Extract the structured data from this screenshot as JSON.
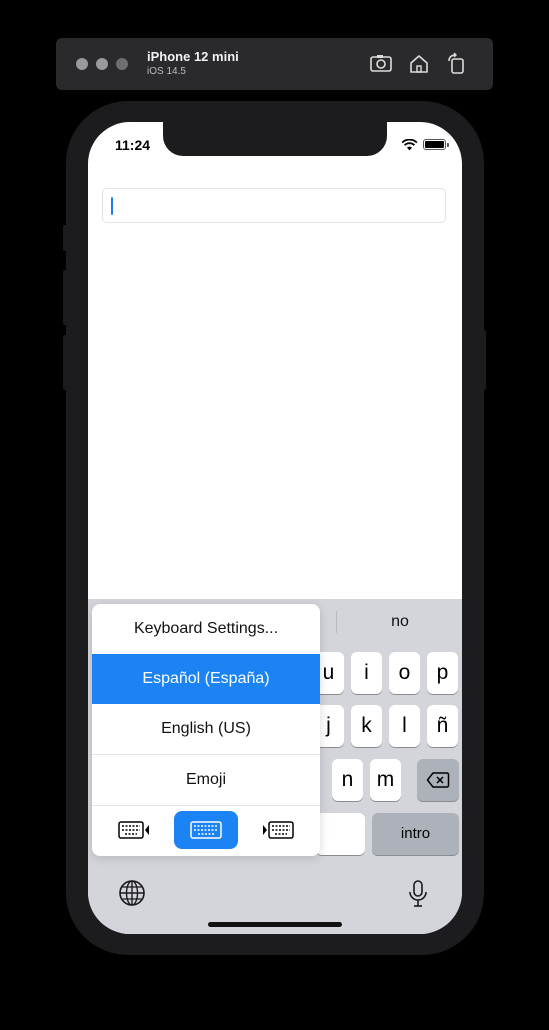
{
  "simulator": {
    "device_name": "iPhone 12 mini",
    "os_version": "iOS 14.5",
    "icons": [
      "screenshot-icon",
      "home-icon",
      "rotate-icon"
    ]
  },
  "status_bar": {
    "time": "11:24"
  },
  "text_field": {
    "value": ""
  },
  "keyboard": {
    "suggestion": "no",
    "keys_row1": [
      "u",
      "i",
      "o",
      "p"
    ],
    "keys_row2": [
      "j",
      "k",
      "l",
      "ñ"
    ],
    "keys_row3": [
      "n",
      "m"
    ],
    "return_label": "intro",
    "icons": [
      "globe-icon",
      "microphone-icon",
      "delete-icon"
    ]
  },
  "input_menu": {
    "items": [
      {
        "label": "Keyboard Settings..."
      },
      {
        "label": "Español (España)",
        "selected": true
      },
      {
        "label": "English (US)"
      },
      {
        "label": "Emoji"
      }
    ],
    "modes": [
      "keyboard-left-icon",
      "keyboard-full-icon",
      "keyboard-right-icon"
    ],
    "active_mode": "keyboard-full-icon"
  },
  "colors": {
    "accent": "#1c83f5",
    "keyboard_bg": "#d3d5db"
  }
}
